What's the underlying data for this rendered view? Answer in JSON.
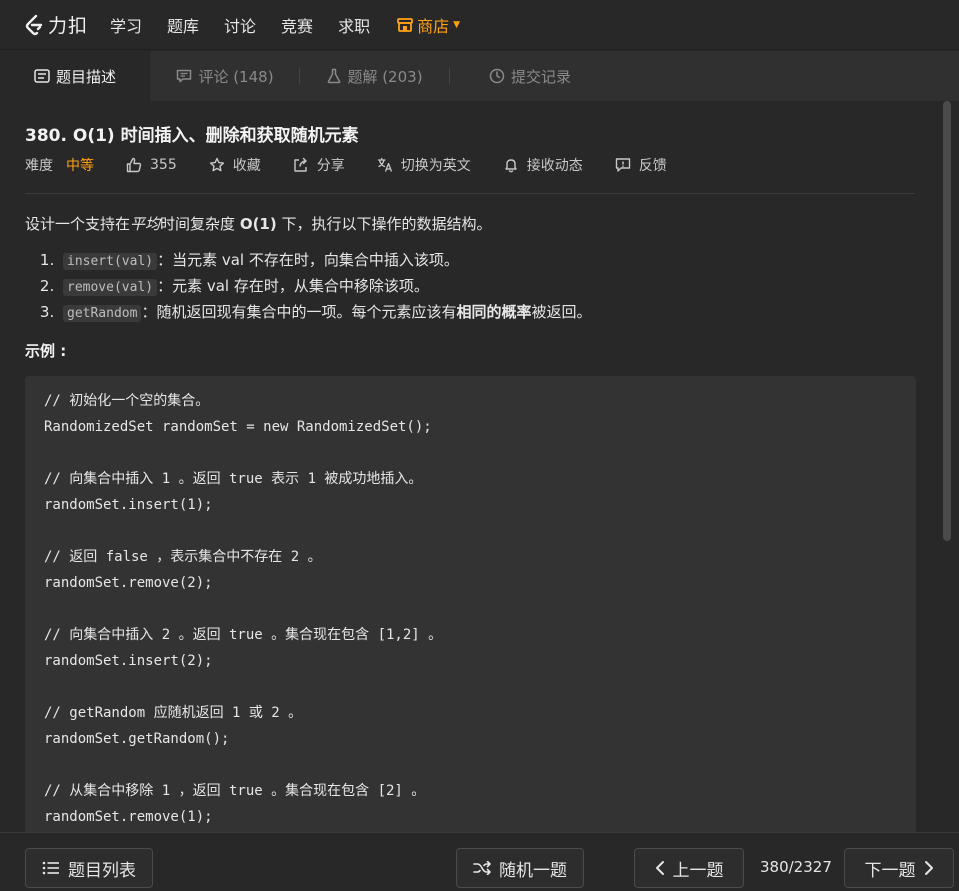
{
  "brand": {
    "name": "力扣"
  },
  "nav": {
    "items": [
      "学习",
      "题库",
      "讨论",
      "竞赛",
      "求职"
    ],
    "shop": "商店"
  },
  "tabs": [
    {
      "label": "题目描述"
    },
    {
      "label": "评论 (148)"
    },
    {
      "label": "题解 (203)"
    },
    {
      "label": "提交记录"
    }
  ],
  "problem": {
    "title": "380. O(1) 时间插入、删除和获取随机元素",
    "difficulty_label": "难度",
    "difficulty": "中等",
    "likes": "355",
    "favorite": "收藏",
    "share": "分享",
    "switch_lang": "切换为英文",
    "subscribe": "接收动态",
    "feedback": "反馈"
  },
  "description": {
    "intro_pre": "设计一个支持在",
    "intro_em": "平均",
    "intro_mid": "时间复杂度 ",
    "intro_bold": "O(1)",
    "intro_post": " 下，执行以下操作的数据结构。",
    "ops": [
      {
        "code": "insert(val)",
        "text": "：当元素 val 不存在时，向集合中插入该项。"
      },
      {
        "code": "remove(val)",
        "text": "：元素 val 存在时，从集合中移除该项。"
      },
      {
        "code": "getRandom",
        "text_pre": "：随机返回现有集合中的一项。每个元素应该有",
        "text_bold": "相同的概率",
        "text_post": "被返回。"
      }
    ],
    "example_title": "示例 :"
  },
  "code_lines": [
    "// 初始化一个空的集合。",
    "RandomizedSet randomSet = new RandomizedSet();",
    "",
    "// 向集合中插入 1 。返回 true 表示 1 被成功地插入。",
    "randomSet.insert(1);",
    "",
    "// 返回 false ，表示集合中不存在 2 。",
    "randomSet.remove(2);",
    "",
    "// 向集合中插入 2 。返回 true 。集合现在包含 [1,2] 。",
    "randomSet.insert(2);",
    "",
    "// getRandom 应随机返回 1 或 2 。",
    "randomSet.getRandom();",
    "",
    "// 从集合中移除 1 ，返回 true 。集合现在包含 [2] 。",
    "randomSet.remove(1);",
    ""
  ],
  "bottom": {
    "list": "题目列表",
    "random": "随机一题",
    "prev": "上一题",
    "counter": "380/2327",
    "next": "下一题"
  },
  "colors": {
    "accent": "#ffa116",
    "background": "#282828",
    "code_bg": "#333333"
  }
}
